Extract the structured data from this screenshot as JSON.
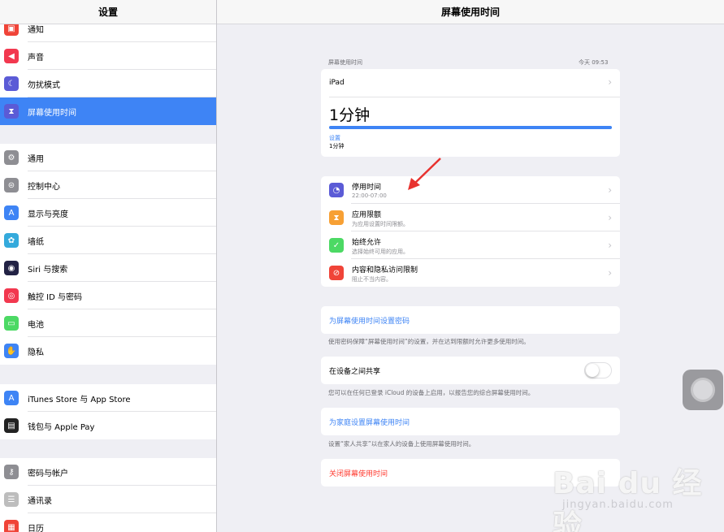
{
  "sidebar": {
    "title": "设置",
    "group1": [
      {
        "label": "通知",
        "icon": "notifications-icon",
        "color": "#f04438"
      },
      {
        "label": "声音",
        "icon": "sound-icon",
        "color": "#f2384f"
      },
      {
        "label": "勿扰模式",
        "icon": "moon-icon",
        "color": "#5b5bd6"
      },
      {
        "label": "屏幕使用时间",
        "icon": "hourglass-icon",
        "color": "#5b5bd6",
        "selected": true
      }
    ],
    "group2": [
      {
        "label": "通用",
        "icon": "gear-icon",
        "color": "#8e8e93"
      },
      {
        "label": "控制中心",
        "icon": "toggles-icon",
        "color": "#8e8e93"
      },
      {
        "label": "显示与亮度",
        "icon": "text-size-icon",
        "color": "#3e84f5"
      },
      {
        "label": "墙纸",
        "icon": "flower-icon",
        "color": "#34aadc"
      },
      {
        "label": "Siri 与搜索",
        "icon": "siri-icon",
        "color": "#222244"
      },
      {
        "label": "触控 ID 与密码",
        "icon": "fingerprint-icon",
        "color": "#f2384f"
      },
      {
        "label": "电池",
        "icon": "battery-icon",
        "color": "#4cd964"
      },
      {
        "label": "隐私",
        "icon": "hand-icon",
        "color": "#3e84f5"
      }
    ],
    "group3": [
      {
        "label": "iTunes Store 与 App Store",
        "icon": "app-store-icon",
        "color": "#3e84f5"
      },
      {
        "label": "钱包与 Apple Pay",
        "icon": "wallet-icon",
        "color": "#222222"
      }
    ],
    "group4": [
      {
        "label": "密码与帐户",
        "icon": "key-icon",
        "color": "#8e8e93"
      },
      {
        "label": "通讯录",
        "icon": "contacts-icon",
        "color": "#bdbdbd"
      },
      {
        "label": "日历",
        "icon": "calendar-icon",
        "color": "#f04438"
      }
    ]
  },
  "main": {
    "title": "屏幕使用时间",
    "summary": {
      "caption": "屏幕使用时间",
      "timestamp": "今天 09:53",
      "device": "iPad",
      "total": "1分钟",
      "progress": 1.0,
      "category_label": "设置",
      "category_time": "1分钟"
    },
    "features": [
      {
        "title": "停用时间",
        "subtitle": "22:00-07:00",
        "icon": "downtime-icon",
        "color": "#5b5bd6"
      },
      {
        "title": "应用限额",
        "subtitle": "为应用设置时间限额。",
        "icon": "hourglass-icon",
        "color": "#f7a034"
      },
      {
        "title": "始终允许",
        "subtitle": "选择始终可用的应用。",
        "icon": "checkmark-icon",
        "color": "#4cd964"
      },
      {
        "title": "内容和隐私访问限制",
        "subtitle": "阻止不当内容。",
        "icon": "restriction-icon",
        "color": "#f04438"
      }
    ],
    "passcode_link": "为屏幕使用时间设置密码",
    "passcode_note": "使用密码保障“屏幕使用时间”的设置，并在达到限额时允许更多使用时间。",
    "share_label": "在设备之间共享",
    "share_on": false,
    "share_note": "您可以在任何已登录 iCloud 的设备上启用，以报告您的综合屏幕使用时间。",
    "family_link": "为家庭设置屏幕使用时间",
    "family_note": "设置“家人共享”以在家人的设备上使用屏幕使用时间。",
    "turn_off": "关闭屏幕使用时间"
  },
  "watermark": {
    "main": "Bai du 经验",
    "sub": "jingyan.baidu.com"
  }
}
